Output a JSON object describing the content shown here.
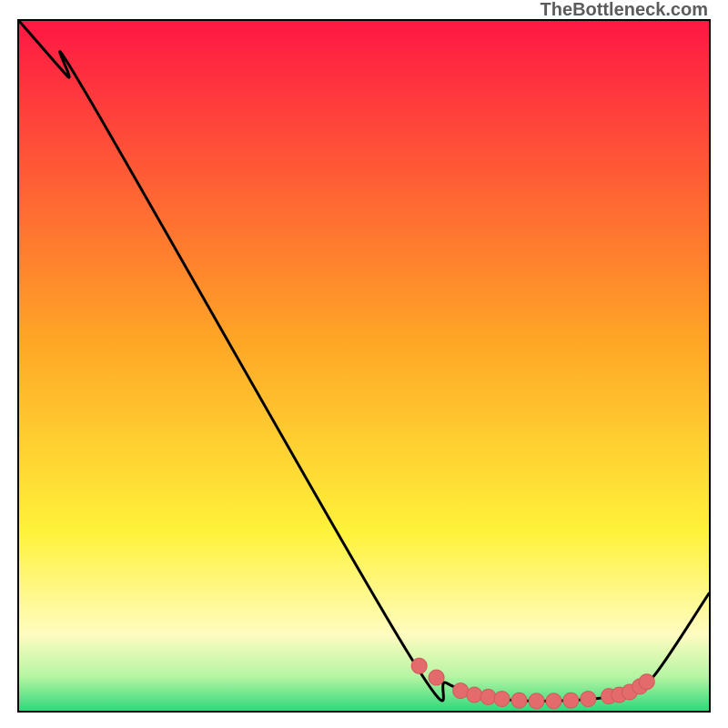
{
  "watermark": "TheBottleneck.com",
  "colors": {
    "red": "#ff1744",
    "orange": "#ffa526",
    "yellow": "#fff23a",
    "paleyellow": "#fffcc0",
    "lightgreen": "#b6f5a3",
    "green": "#2fd97a",
    "marker": "#e46b6b",
    "marker_stroke": "#cf5a5a",
    "curve": "#000000"
  },
  "chart_data": {
    "type": "line",
    "title": "",
    "xlabel": "",
    "ylabel": "",
    "xlim": [
      0,
      100
    ],
    "ylim": [
      0,
      100
    ],
    "series": [
      {
        "name": "bottleneck-curve",
        "x": [
          0,
          7,
          10,
          56,
          62,
          68,
          72,
          76,
          80,
          84,
          88,
          92,
          100
        ],
        "y": [
          100,
          92,
          89,
          9,
          4,
          2,
          1.5,
          1.4,
          1.5,
          1.8,
          2.5,
          5,
          17
        ]
      }
    ],
    "markers": [
      {
        "x": 58.0,
        "y": 6.5
      },
      {
        "x": 60.5,
        "y": 4.8
      },
      {
        "x": 64.0,
        "y": 2.9
      },
      {
        "x": 66.0,
        "y": 2.3
      },
      {
        "x": 68.0,
        "y": 2.0
      },
      {
        "x": 70.0,
        "y": 1.7
      },
      {
        "x": 72.5,
        "y": 1.5
      },
      {
        "x": 75.0,
        "y": 1.4
      },
      {
        "x": 77.5,
        "y": 1.4
      },
      {
        "x": 80.0,
        "y": 1.5
      },
      {
        "x": 82.5,
        "y": 1.7
      },
      {
        "x": 85.5,
        "y": 2.1
      },
      {
        "x": 87.0,
        "y": 2.3
      },
      {
        "x": 88.5,
        "y": 2.7
      },
      {
        "x": 90.0,
        "y": 3.5
      },
      {
        "x": 91.0,
        "y": 4.2
      }
    ],
    "gradient_stops": [
      {
        "pct": 0,
        "color_key": "red"
      },
      {
        "pct": 46,
        "color_key": "orange"
      },
      {
        "pct": 74,
        "color_key": "yellow"
      },
      {
        "pct": 89,
        "color_key": "paleyellow"
      },
      {
        "pct": 95,
        "color_key": "lightgreen"
      },
      {
        "pct": 100,
        "color_key": "green"
      }
    ]
  }
}
